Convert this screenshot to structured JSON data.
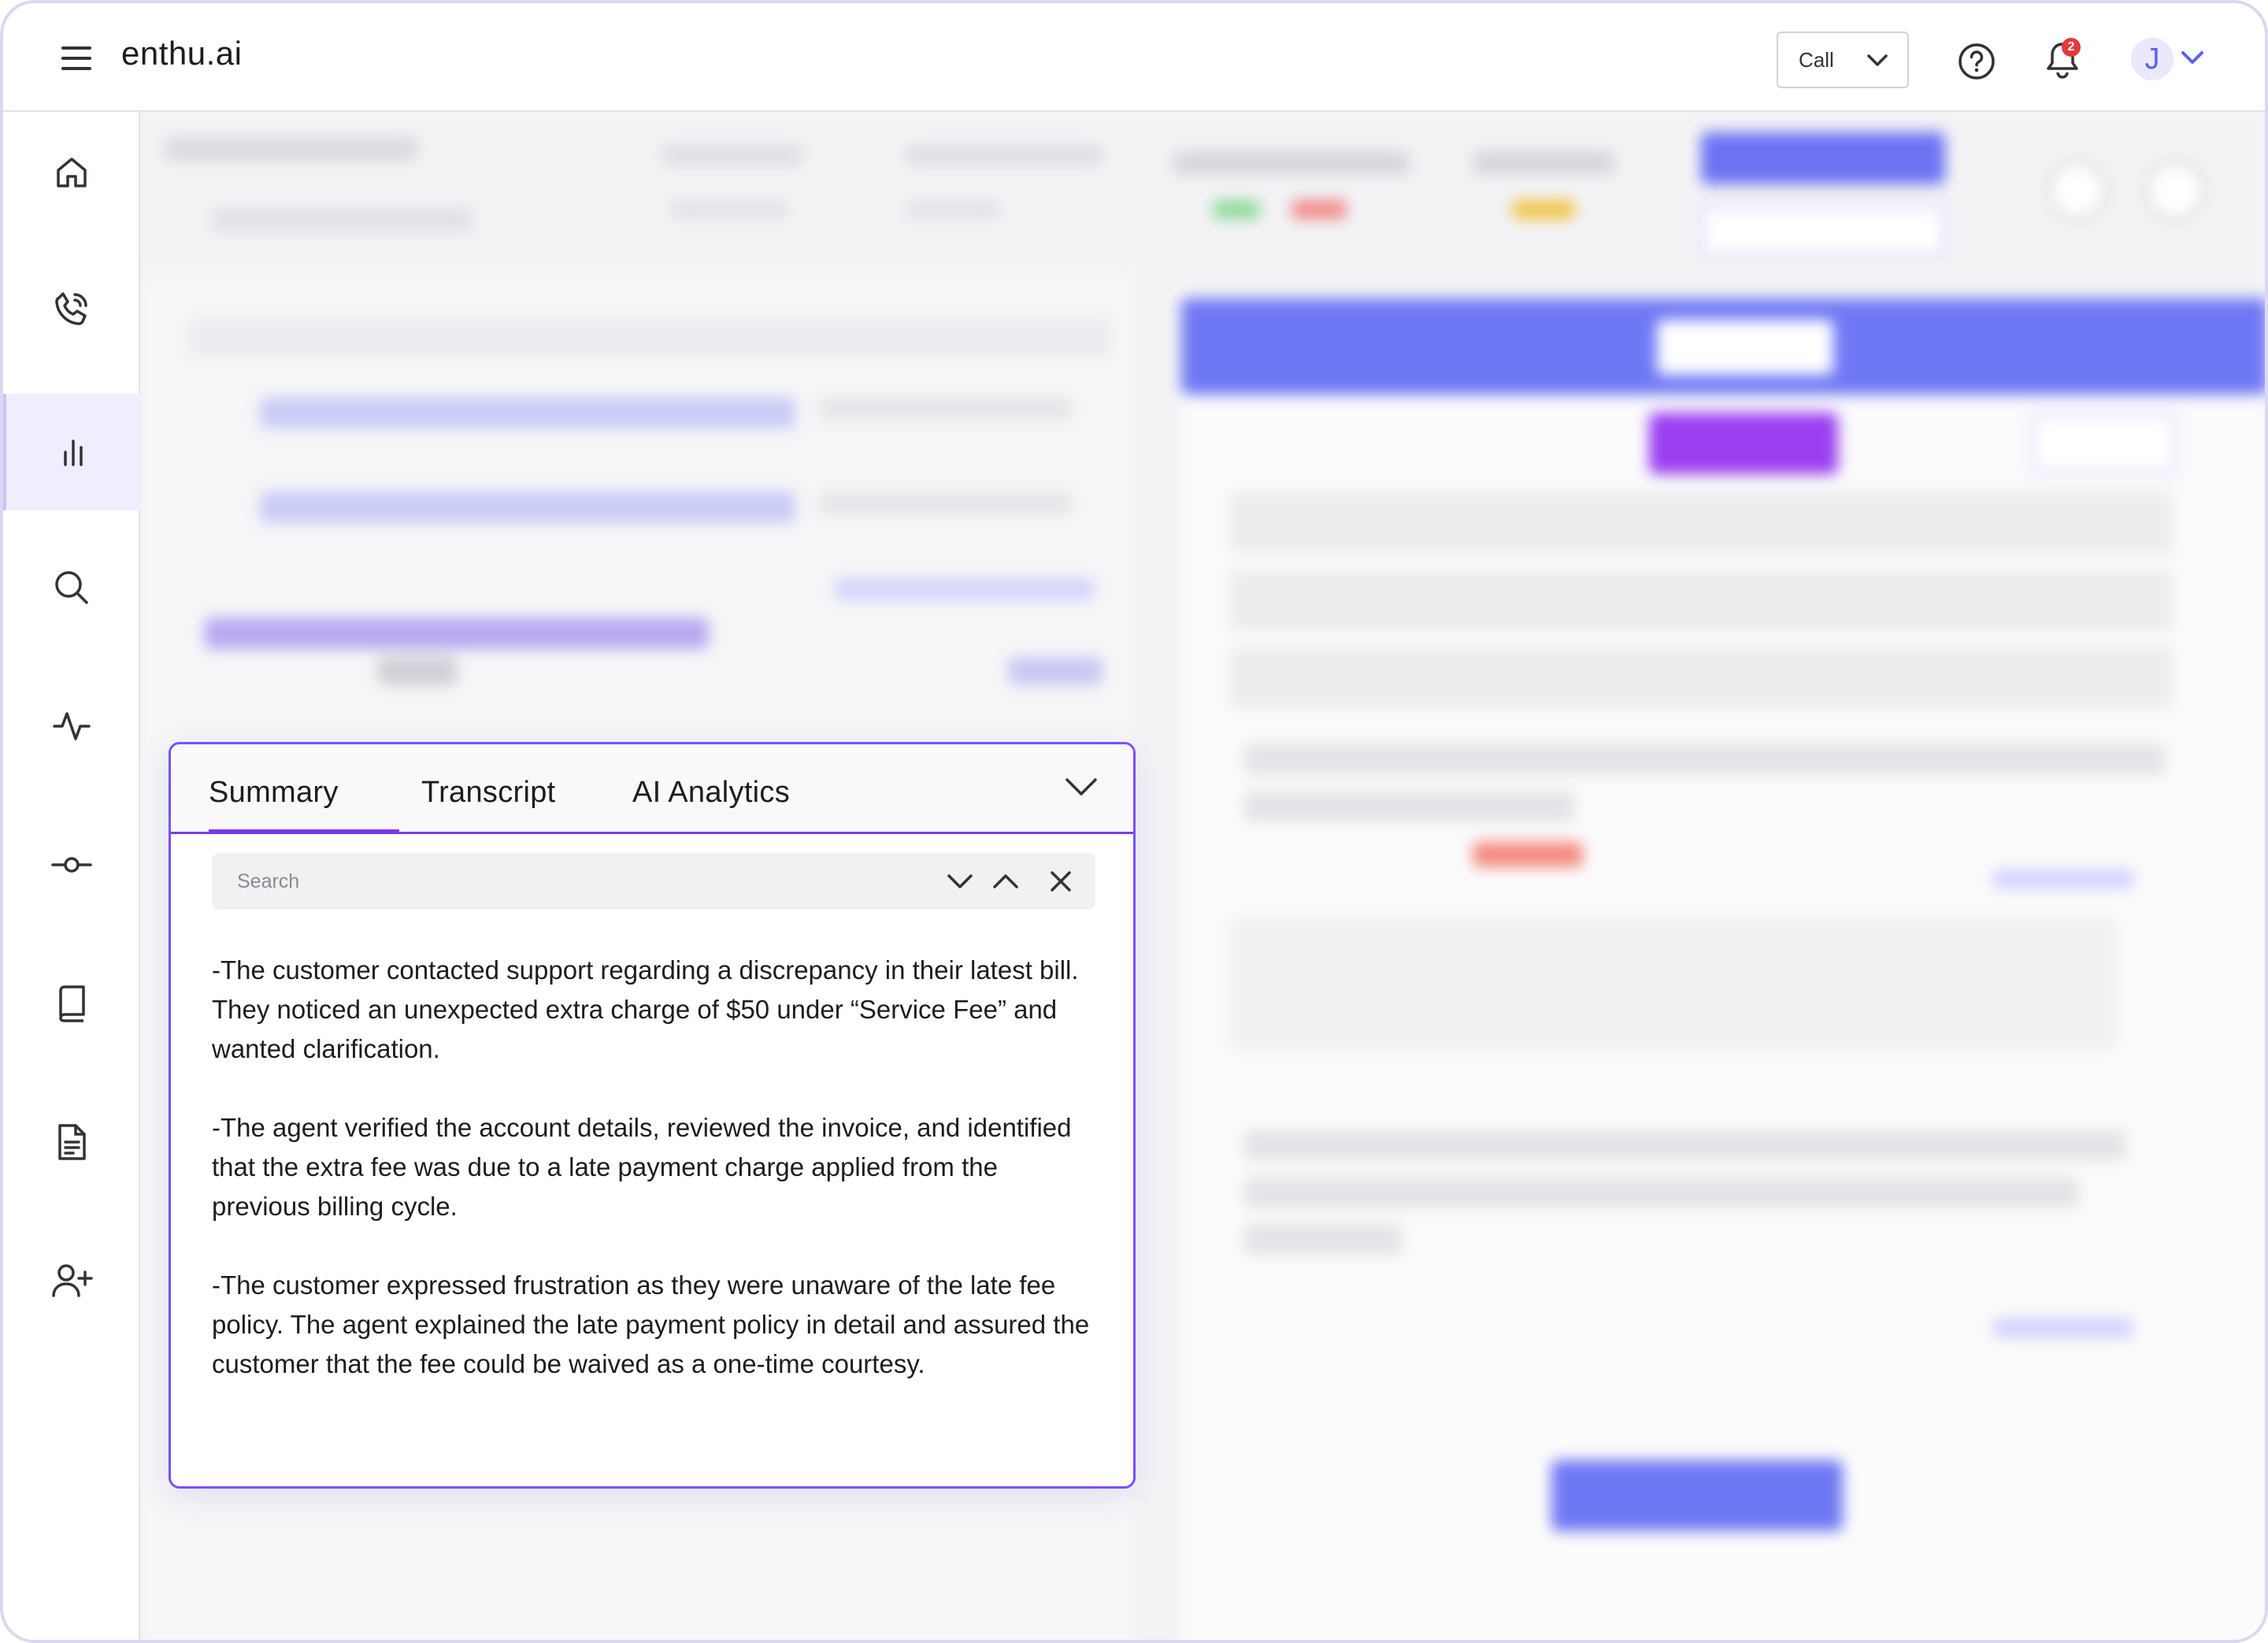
{
  "app": {
    "brand": "enthu.ai"
  },
  "header": {
    "call_select": {
      "selected": "Call"
    },
    "notification_count": "2",
    "avatar_initial": "J",
    "icons": [
      "menu-icon",
      "help-icon",
      "bell-icon",
      "chevron-down-icon"
    ]
  },
  "sidebar": {
    "items": [
      {
        "icon": "home-icon"
      },
      {
        "icon": "phone-call-icon"
      },
      {
        "icon": "analytics-icon",
        "active": true
      },
      {
        "icon": "search-icon"
      },
      {
        "icon": "activity-icon"
      },
      {
        "icon": "commit-icon"
      },
      {
        "icon": "book-icon"
      },
      {
        "icon": "document-icon"
      },
      {
        "icon": "add-user-icon"
      }
    ]
  },
  "summary_panel": {
    "tabs": [
      {
        "label": "Summary",
        "active": true
      },
      {
        "label": "Transcript",
        "active": false
      },
      {
        "label": "AI Analytics",
        "active": false
      }
    ],
    "search": {
      "placeholder": "Search",
      "value": ""
    },
    "paragraphs": [
      "-The customer contacted support regarding a discrepancy in their latest bill. They noticed an unexpected extra charge of $50 under “Service Fee” and wanted clarification.",
      "-The agent verified the account details, reviewed the invoice, and identified that the extra fee was due to a late payment charge applied from the previous billing cycle.",
      "-The customer expressed frustration as they were unaware of the late fee policy. The agent explained the late payment policy in detail and assured the customer that the fee could be waived as a one-time courtesy."
    ]
  },
  "colors": {
    "accent": "#7c3aed",
    "panel_border": "#7c4dff",
    "brand_blue": "#5b63f0",
    "badge_red": "#e5383b"
  }
}
